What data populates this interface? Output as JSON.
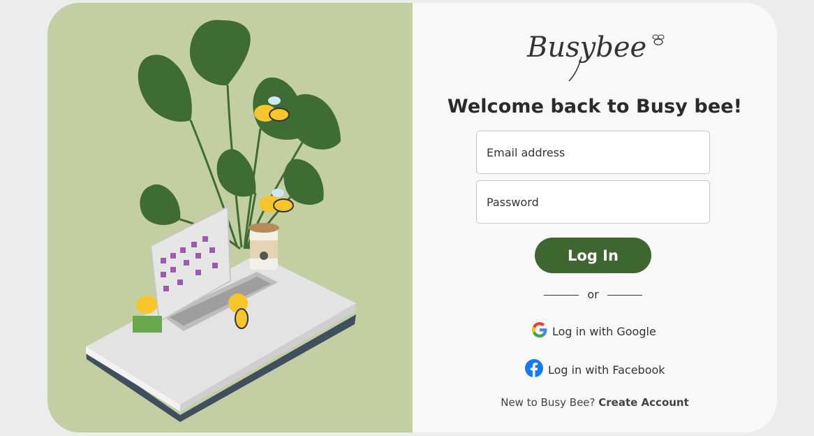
{
  "brand": {
    "logo_text": "Busybee"
  },
  "login": {
    "title": "Welcome back to Busy bee!",
    "email_placeholder": "Email address",
    "password_placeholder": "Password",
    "submit_label": "Log In",
    "divider_text": "or",
    "google_label": "Log in with Google",
    "facebook_label": "Log in with Facebook",
    "signup_prompt": "New to Busy Bee?",
    "signup_link": "Create Account"
  },
  "colors": {
    "left_panel": "#c4cea3",
    "accent_green": "#3e6631",
    "card_bg": "#f8f8f8",
    "facebook_blue": "#1877f2"
  },
  "illustration": {
    "description_icon": "workspace-plant-bees-illustration"
  }
}
